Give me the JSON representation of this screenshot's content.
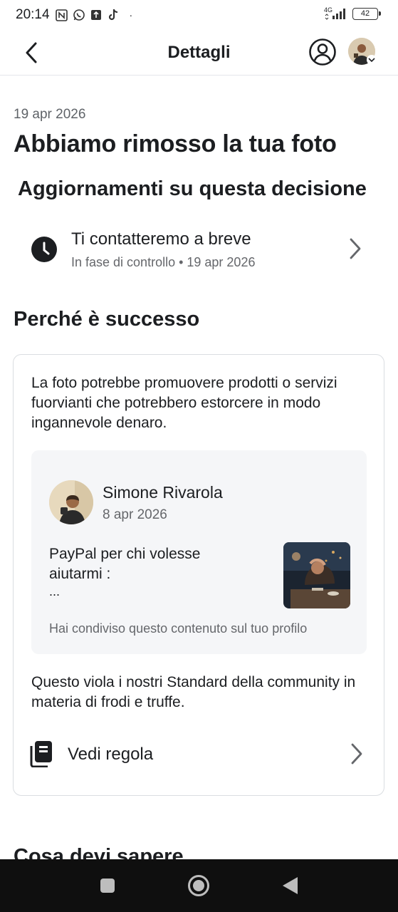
{
  "status_bar": {
    "time": "20:14",
    "network": "4G",
    "battery": "42"
  },
  "header": {
    "title": "Dettagli"
  },
  "content": {
    "date": "19 apr 2026",
    "title": "Abbiamo rimosso la tua foto",
    "updates_heading": "Aggiornamenti su questa decisione",
    "update": {
      "title": "Ti contatteremo a breve",
      "subtitle": "In fase di controllo • 19 apr 2026"
    },
    "why_heading": "Perché è successo",
    "card": {
      "reason": "La foto potrebbe promuovere prodotti o servizi fuorvianti che potrebbero estorcere in modo ingannevole denaro.",
      "post": {
        "author": "Simone Rivarola",
        "date": "8 apr 2026",
        "text": "PayPal per chi volesse aiutarmi :",
        "ellipsis": "...",
        "note": "Hai condiviso questo contenuto sul tuo profilo"
      },
      "violation": "Questo viola i nostri Standard della community in materia di frodi e truffe.",
      "rule_label": "Vedi regola"
    },
    "know_heading": "Cosa devi sapere"
  },
  "colors": {
    "text_primary": "#1c1e21",
    "text_secondary": "#65676b",
    "card_border": "#dadde1",
    "post_bg": "#f5f6f8",
    "nav_bg": "#0f0f0f"
  },
  "icons": [
    "back-arrow-icon",
    "account-circle-icon",
    "clock-icon",
    "chevron-right-icon",
    "rule-book-icon",
    "nav-square-icon",
    "nav-home-icon",
    "nav-back-icon"
  ]
}
